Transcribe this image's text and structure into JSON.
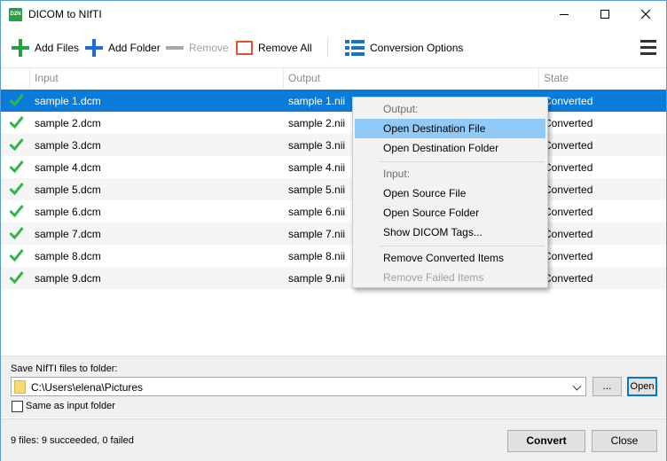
{
  "window": {
    "title": "DICOM to NIfTI",
    "app_icon_text": "D2N"
  },
  "toolbar": {
    "add_files": "Add Files",
    "add_folder": "Add Folder",
    "remove": "Remove",
    "remove_all": "Remove All",
    "conversion_options": "Conversion Options"
  },
  "list": {
    "columns": [
      "Input",
      "Output",
      "State"
    ],
    "rows": [
      {
        "input": "sample 1.dcm",
        "output": "sample 1.nii",
        "state": "Converted"
      },
      {
        "input": "sample 2.dcm",
        "output": "sample 2.nii",
        "state": "Converted"
      },
      {
        "input": "sample 3.dcm",
        "output": "sample 3.nii",
        "state": "Converted"
      },
      {
        "input": "sample 4.dcm",
        "output": "sample 4.nii",
        "state": "Converted"
      },
      {
        "input": "sample 5.dcm",
        "output": "sample 5.nii",
        "state": "Converted"
      },
      {
        "input": "sample 6.dcm",
        "output": "sample 6.nii",
        "state": "Converted"
      },
      {
        "input": "sample 7.dcm",
        "output": "sample 7.nii",
        "state": "Converted"
      },
      {
        "input": "sample 8.dcm",
        "output": "sample 8.nii",
        "state": "Converted"
      },
      {
        "input": "sample 9.dcm",
        "output": "sample 9.nii",
        "state": "Converted"
      }
    ]
  },
  "context_menu": {
    "output_header": "Output:",
    "open_destination_file": "Open Destination File",
    "open_destination_folder": "Open Destination Folder",
    "input_header": "Input:",
    "open_source_file": "Open Source File",
    "open_source_folder": "Open Source Folder",
    "show_dicom_tags": "Show DICOM Tags...",
    "remove_converted": "Remove Converted Items",
    "remove_failed": "Remove Failed Items"
  },
  "output_folder": {
    "label": "Save NIfTI files to folder:",
    "path": "C:\\Users\\elena\\Pictures",
    "browse_label": "...",
    "open_label": "Open",
    "same_as_input_label": "Same as input folder",
    "same_as_input_checked": false
  },
  "status": {
    "text": "9 files: 9 succeeded, 0 failed",
    "convert_label": "Convert",
    "close_label": "Close"
  },
  "colors": {
    "accent": "#0a7bd8",
    "success": "#2db84a",
    "add_icon": "#26a045",
    "folder_icon": "#1a73c9",
    "remove_all_icon": "#e0542b",
    "menu_highlight": "#91c9f7"
  },
  "icons": {
    "add_files": "plus-icon",
    "add_folder": "plus-icon",
    "remove": "minus-icon",
    "remove_all": "square-icon",
    "conversion_options": "list-icon",
    "menu": "hamburger-icon",
    "row_state": "checkmark-icon"
  }
}
